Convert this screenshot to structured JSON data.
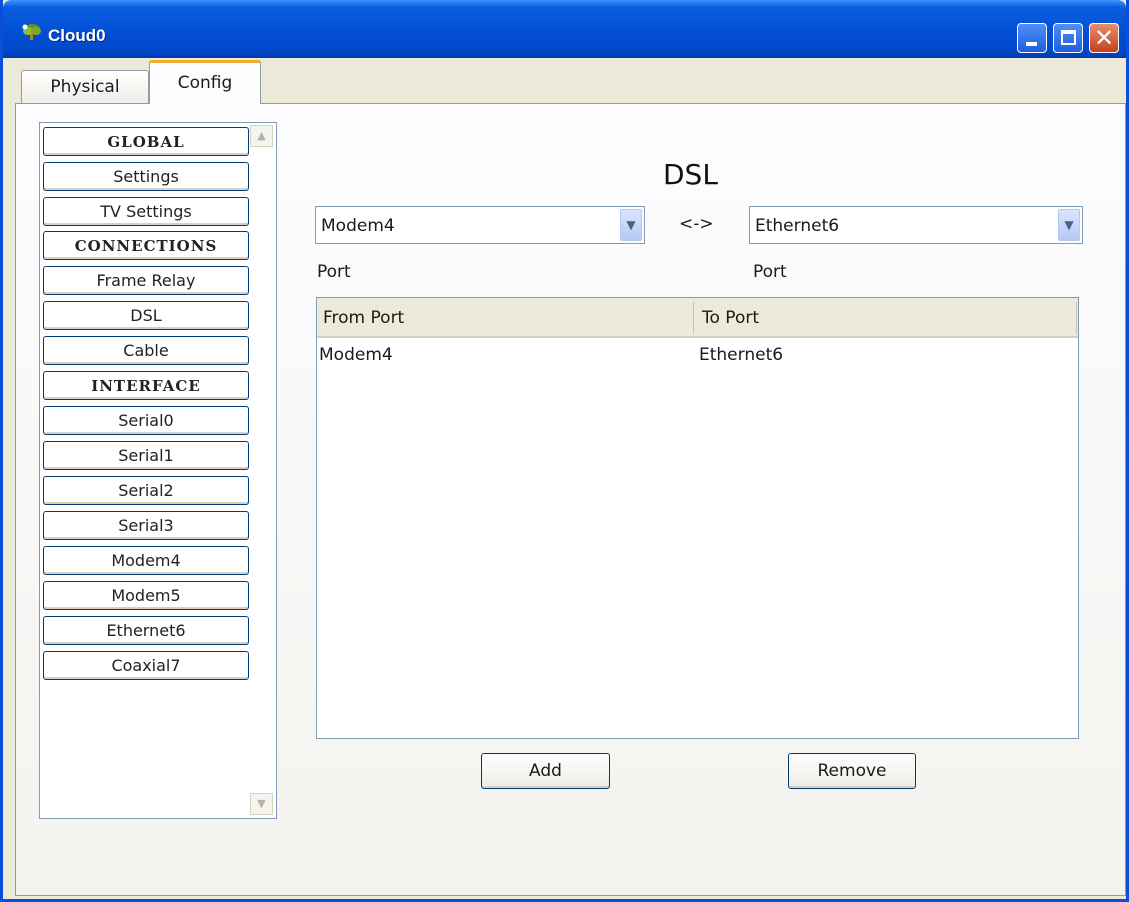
{
  "window": {
    "title": "Cloud0"
  },
  "tabs": [
    {
      "label": "Physical"
    },
    {
      "label": "Config"
    }
  ],
  "sidebar": {
    "items": [
      {
        "label": "GLOBAL",
        "header": true
      },
      {
        "label": "Settings"
      },
      {
        "label": "TV Settings"
      },
      {
        "label": "CONNECTIONS",
        "header": true
      },
      {
        "label": "Frame Relay"
      },
      {
        "label": "DSL"
      },
      {
        "label": "Cable"
      },
      {
        "label": "INTERFACE",
        "header": true
      },
      {
        "label": "Serial0"
      },
      {
        "label": "Serial1"
      },
      {
        "label": "Serial2"
      },
      {
        "label": "Serial3"
      },
      {
        "label": "Modem4"
      },
      {
        "label": "Modem5"
      },
      {
        "label": "Ethernet6"
      },
      {
        "label": "Coaxial7"
      }
    ]
  },
  "main": {
    "title": "DSL",
    "from_select": "Modem4",
    "to_select": "Ethernet6",
    "separator": "<->",
    "from_port_label": "Port",
    "to_port_label": "Port",
    "table": {
      "columns": [
        "From Port",
        "To Port"
      ],
      "rows": [
        {
          "from": "Modem4",
          "to": "Ethernet6"
        }
      ]
    },
    "add_label": "Add",
    "remove_label": "Remove"
  },
  "colors": {
    "titlebar": "#0351d6",
    "tab_highlight": "#f4a82d",
    "button_border": "#003c74"
  }
}
